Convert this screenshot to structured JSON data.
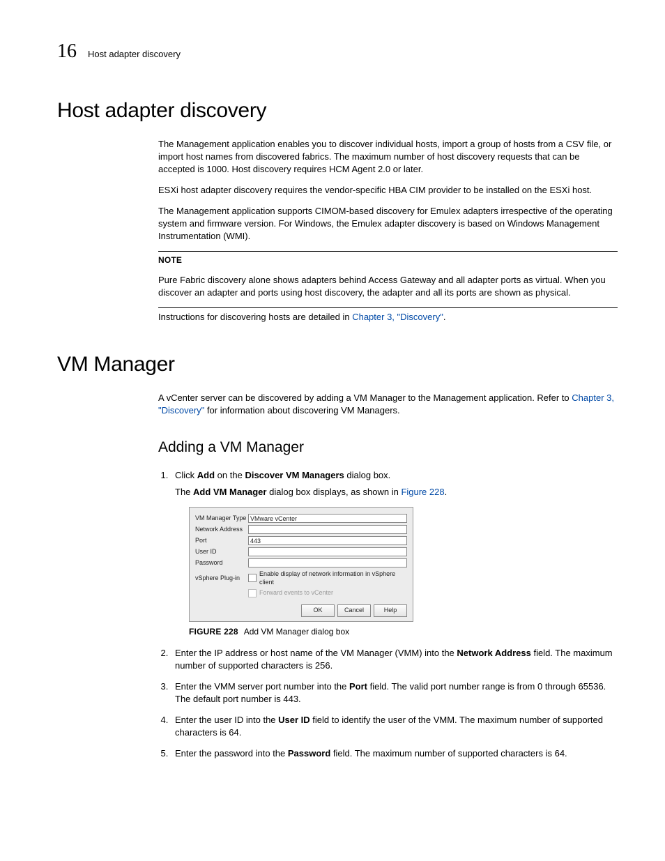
{
  "header": {
    "chapter_number": "16",
    "section_name": "Host adapter discovery"
  },
  "section1": {
    "title": "Host adapter discovery",
    "p1": "The Management application enables you to discover individual hosts, import a group of hosts from a CSV file, or import host names from discovered fabrics. The maximum number of host discovery requests that can be accepted is 1000. Host discovery requires HCM Agent 2.0 or later.",
    "p2": "ESXi host adapter discovery requires the vendor-specific HBA CIM provider to be installed on the ESXi host.",
    "p3": "The Management application supports CIMOM-based discovery for Emulex adapters irrespective of the operating system and firmware version. For Windows, the Emulex adapter discovery is based on Windows Management Instrumentation (WMI).",
    "note_label": "NOTE",
    "note_text": "Pure Fabric discovery alone shows adapters behind Access Gateway and all adapter ports as virtual. When you discover an adapter and ports using host discovery, the adapter and all its ports are shown as physical.",
    "instr_prefix": "Instructions for discovering hosts are detailed in ",
    "instr_link": "Chapter 3, \"Discovery\"",
    "instr_suffix": "."
  },
  "section2": {
    "title": "VM Manager",
    "intro_prefix": "A vCenter server can be discovered by adding a VM Manager to the Management application. Refer to ",
    "intro_link": "Chapter 3, \"Discovery\"",
    "intro_suffix": " for information about discovering VM Managers.",
    "subsection_title": "Adding a VM Manager",
    "step1_a": "Click ",
    "step1_b": "Add",
    "step1_c": " on the ",
    "step1_d": "Discover VM Managers",
    "step1_e": " dialog box.",
    "step1_sub_a": "The ",
    "step1_sub_b": "Add VM Manager",
    "step1_sub_c": " dialog box displays, as shown in ",
    "step1_sub_link": "Figure 228",
    "step1_sub_d": ".",
    "figure_label": "FIGURE 228",
    "figure_caption": "Add VM Manager dialog box",
    "step2_a": "Enter the IP address or host name of the VM Manager (VMM) into the ",
    "step2_b": "Network Address",
    "step2_c": " field. The maximum number of supported characters is 256.",
    "step3_a": "Enter the VMM server port number into the ",
    "step3_b": "Port",
    "step3_c": " field. The valid port number range is from 0 through 65536. The default port number is 443.",
    "step4_a": "Enter the user ID into the ",
    "step4_b": "User ID",
    "step4_c": " field to identify the user of the VMM. The maximum number of supported characters is 64.",
    "step5_a": "Enter the password into the ",
    "step5_b": "Password",
    "step5_c": " field. The maximum number of supported characters is 64."
  },
  "dialog": {
    "labels": {
      "vm_type": "VM Manager Type",
      "network_address": "Network Address",
      "port": "Port",
      "user_id": "User ID",
      "password": "Password",
      "vsphere": "vSphere Plug-in"
    },
    "values": {
      "vm_type": "VMware vCenter",
      "port": "443"
    },
    "checkbox1": "Enable display of network information in vSphere client",
    "checkbox2": "Forward events to vCenter",
    "buttons": {
      "ok": "OK",
      "cancel": "Cancel",
      "help": "Help"
    }
  }
}
